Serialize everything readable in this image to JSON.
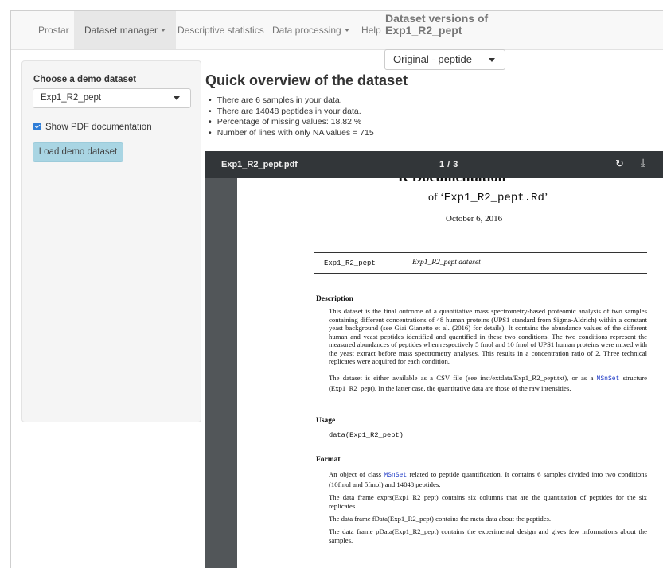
{
  "navbar": {
    "brand": "Prostar",
    "menu_dataset_manager": "Dataset manager",
    "menu_descriptive_stats": "Descriptive statistics",
    "menu_data_processing": "Data processing",
    "menu_help": "Help",
    "versions_title_line1": "Dataset versions of",
    "versions_title_line2": "Exp1_R2_pept",
    "version_selected": "Original - peptide"
  },
  "sidebar": {
    "choose_label": "Choose a demo dataset",
    "dataset_selected": "Exp1_R2_pept",
    "show_pdf_label": "Show PDF documentation",
    "show_pdf_checked": true,
    "load_button": "Load demo dataset"
  },
  "main": {
    "title": "Quick overview of the dataset",
    "bullets": [
      "There are 6 samples in your data.",
      "There are 14048 peptides in your data.",
      "Percentage of missing values: 18.82 %",
      "Number of lines with only NA values = 715"
    ]
  },
  "pdf": {
    "filename": "Exp1_R2_pept.pdf",
    "page_indicator": "1 / 3",
    "rotate_icon": "↻",
    "download_icon": "⤓",
    "doc_title_cut": "R Documentation",
    "doc_of_prefix": "of ‘",
    "doc_of_name": "Exp1_R2_pept.Rd",
    "doc_of_suffix": "’",
    "doc_date": "October 6, 2016",
    "entry_name": "Exp1_R2_pept",
    "entry_alias": "Exp1_R2_pept dataset",
    "h_description": "Description",
    "description_p1": "This dataset is the final outcome of a quantitative mass spectrometry-based proteomic analysis of two samples containing different concentrations of 48 human proteins (UPS1 standard from Sigma-Aldrich) within a constant yeast background (see Giai Gianetto et al. (2016) for details). It contains the abundance values of the different human and yeast peptides identified and quantified in these two conditions. The two conditions represent the measured abundances of peptides when respectively 5 fmol and 10 fmol of UPS1 human proteins were mixed with the yeast extract before mass spectrometry analyses. This results in a concentration ratio of 2. Three technical replicates were acquired for each condition.",
    "description_p2_a": "The dataset is either available as a CSV file (see inst/extdata/Exp1_R2_pept.txt), or as a ",
    "description_p2_kw": "MSnSet",
    "description_p2_b": " structure (Exp1_R2_pept). In the latter case, the quantitative data are those of the raw intensities.",
    "h_usage": "Usage",
    "usage_code": "data(Exp1_R2_pept)",
    "h_format": "Format",
    "format_p1_a": "An object of class ",
    "format_p1_kw": "MSnSet",
    "format_p1_b": " related to peptide quantification. It contains 6 samples divided into two conditions (10fmol and 5fmol) and 14048 peptides.",
    "format_p2": "The data frame exprs(Exp1_R2_pept) contains six columns that are the quantitation of peptides for the six replicates.",
    "format_p3": "The data frame fData(Exp1_R2_pept) contains the meta data about the peptides.",
    "format_p4": "The data frame pData(Exp1_R2_pept) contains the experimental design and gives few informations about the samples."
  }
}
